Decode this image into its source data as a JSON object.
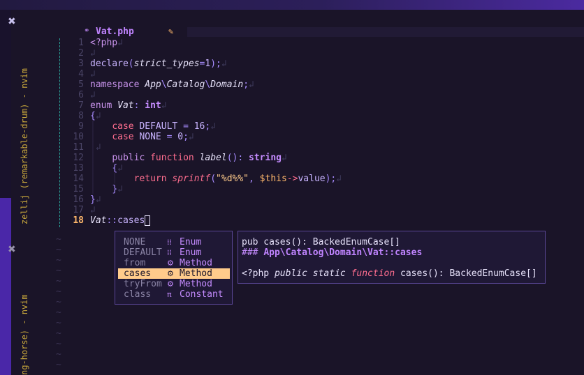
{
  "colors": {
    "background": "#1a1428",
    "accent": "#c084ff",
    "cursor_line": "#ffb86c",
    "selection": "#ffcb8b",
    "keyword": "#ff6e8f",
    "string": "#ffcb8b"
  },
  "panes": [
    {
      "title": "zellij (remarkable-drum) - nvim",
      "close_icon": "✖"
    },
    {
      "title": "ng-horse) - nvim",
      "close_icon": "✖"
    }
  ],
  "tab": {
    "icon": "php-file-icon",
    "icon_glyph": "⚭",
    "filename": "Vat.php",
    "modified_glyph": "✎"
  },
  "editor": {
    "line_numbers": [
      "1",
      "2",
      "3",
      "4",
      "5",
      "6",
      "7",
      "8",
      "9",
      "10",
      "11",
      "12",
      "13",
      "14",
      "15",
      "16",
      "17",
      "18"
    ],
    "eol_marker": "↲",
    "code": {
      "l1": "<?php",
      "l3_declare": "declare",
      "l3_arg": "strict_types",
      "l3_val": "1",
      "l5_ns": "namespace",
      "l5_path_1": "App",
      "l5_path_2": "Catalog",
      "l5_path_3": "Domain",
      "l7_enum": "enum",
      "l7_name": "Vat",
      "l7_type": "int",
      "l9_case": "case",
      "l9_name": "DEFAULT",
      "l9_val": "16",
      "l10_case": "case",
      "l10_name": "NONE",
      "l10_val": "0",
      "l12_public": "public",
      "l12_function": "function",
      "l12_name": "label",
      "l12_ret": "string",
      "l14_return": "return",
      "l14_fn": "sprintf",
      "l14_str": "\"%d%%\"",
      "l14_var": "$this",
      "l14_arrow": "->",
      "l14_prop": "value",
      "l18_class": "Vat",
      "l18_sep": "::",
      "l18_method": "cases"
    },
    "empty_line_marker": "~"
  },
  "completion": {
    "items": [
      {
        "name": "NONE",
        "icon": "enum-icon",
        "glyph": "⁞⁞",
        "kind": "Enum",
        "selected": false
      },
      {
        "name": "DEFAULT",
        "icon": "enum-icon",
        "glyph": "⁞⁞",
        "kind": "Enum",
        "selected": false
      },
      {
        "name": "from",
        "icon": "method-icon",
        "glyph": "⚙",
        "kind": "Method",
        "selected": false
      },
      {
        "name": "cases",
        "icon": "method-icon",
        "glyph": "⚙",
        "kind": "Method",
        "selected": true
      },
      {
        "name": "tryFrom",
        "icon": "method-icon",
        "glyph": "⚙",
        "kind": "Method",
        "selected": false
      },
      {
        "name": "class",
        "icon": "constant-icon",
        "glyph": "π",
        "kind": "Constant",
        "selected": false
      }
    ]
  },
  "docs": {
    "signature": "pub cases(): BackedEnumCase[]",
    "heading_prefix": "###",
    "heading_path": "App\\Catalog\\Domain\\Vat::cases",
    "php_tag": "<?php",
    "mod_public": "public",
    "mod_static": "static",
    "kw_function": "function",
    "fn_name": "cases",
    "fn_rest": "(): BackedEnumCase[]"
  }
}
